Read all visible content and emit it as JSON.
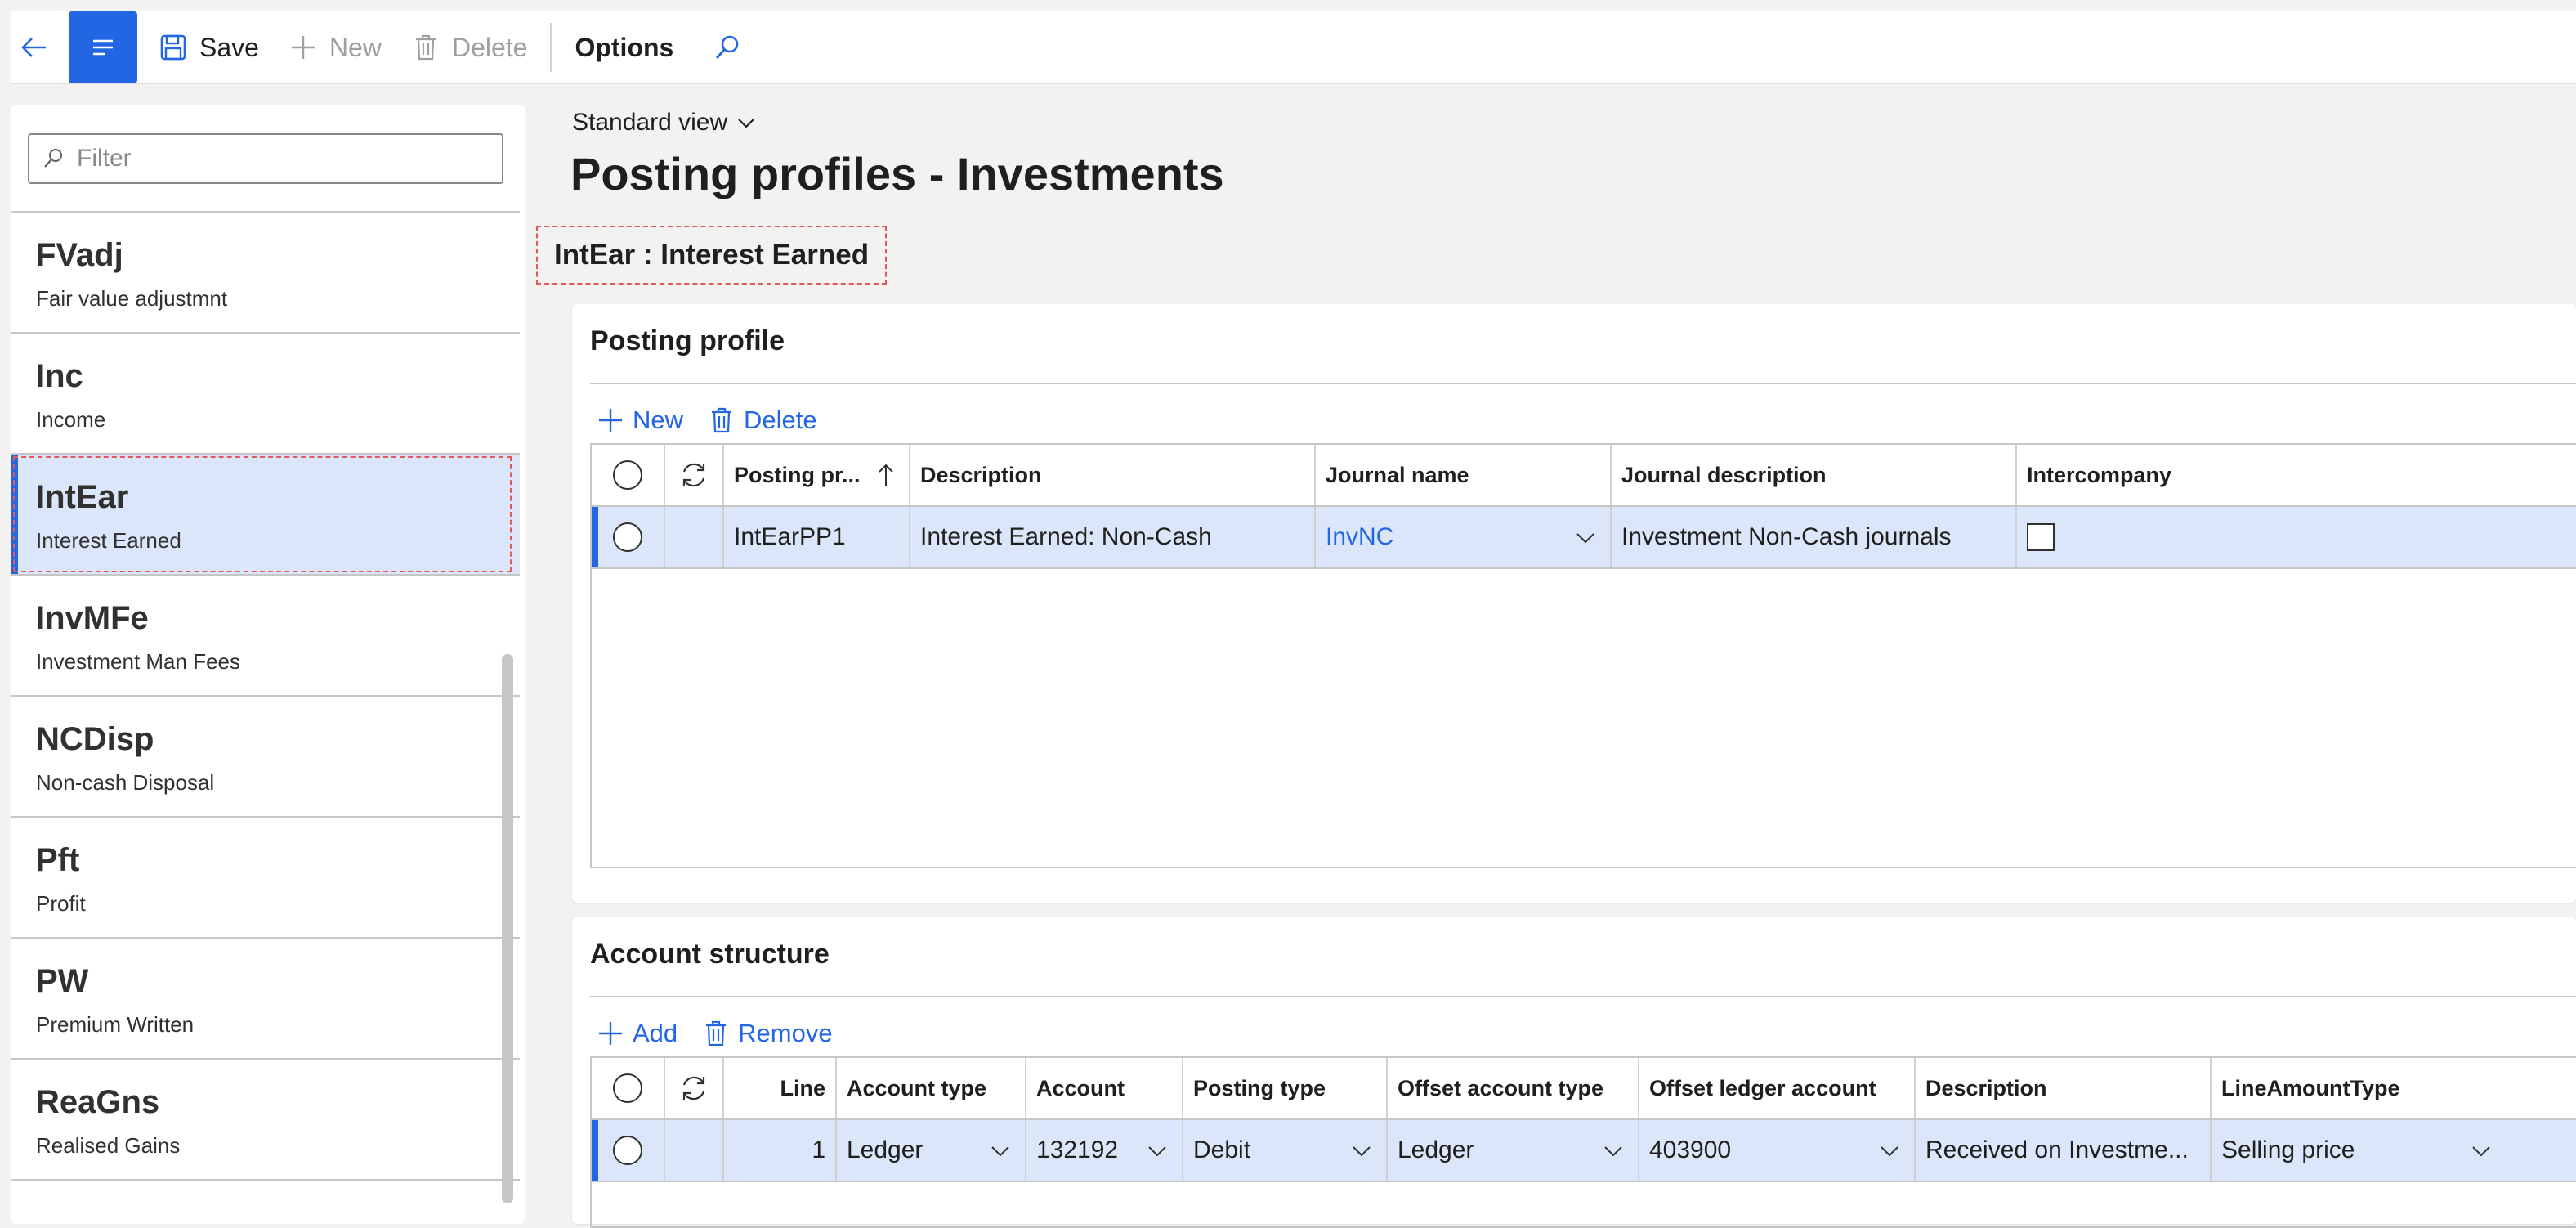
{
  "actionbar": {
    "save_label": "Save",
    "new_label": "New",
    "delete_label": "Delete",
    "options_label": "Options",
    "icons": [
      "back-arrow-icon",
      "hamburger-menu-icon",
      "save-icon",
      "plus-icon",
      "trash-icon",
      "search-icon"
    ]
  },
  "sidebar": {
    "filter_placeholder": "Filter",
    "items": [
      {
        "code": "FVadj",
        "description": "Fair value adjustmnt",
        "selected": false
      },
      {
        "code": "Inc",
        "description": "Income",
        "selected": false
      },
      {
        "code": "IntEar",
        "description": "Interest Earned",
        "selected": true
      },
      {
        "code": "InvMFe",
        "description": "Investment Man Fees",
        "selected": false
      },
      {
        "code": "NCDisp",
        "description": "Non-cash Disposal",
        "selected": false
      },
      {
        "code": "Pft",
        "description": "Profit",
        "selected": false
      },
      {
        "code": "PW",
        "description": "Premium Written",
        "selected": false
      },
      {
        "code": "ReaGns",
        "description": "Realised Gains",
        "selected": false
      }
    ]
  },
  "main": {
    "view_label": "Standard view",
    "page_title": "Posting profiles - Investments",
    "record_title": "IntEar : Interest Earned"
  },
  "posting_profile": {
    "title": "Posting profile",
    "new_label": "New",
    "delete_label": "Delete",
    "columns": [
      "Posting pr...",
      "Description",
      "Journal name",
      "Journal description",
      "Intercompany"
    ],
    "rows": [
      {
        "posting_profile": "IntEarPP1",
        "description": "Interest Earned: Non-Cash",
        "journal_name": "InvNC",
        "journal_description": "Investment Non-Cash journals",
        "intercompany": false
      }
    ]
  },
  "account_structure": {
    "title": "Account structure",
    "add_label": "Add",
    "remove_label": "Remove",
    "columns": [
      "Line",
      "Account type",
      "Account",
      "Posting type",
      "Offset account type",
      "Offset ledger account",
      "Description",
      "LineAmountType"
    ],
    "rows": [
      {
        "line": "1",
        "account_type": "Ledger",
        "account": "132192",
        "posting_type": "Debit",
        "offset_account_type": "Ledger",
        "offset_ledger_account": "403900",
        "description": "Received on Investme...",
        "line_amount_type": "Selling price"
      }
    ]
  },
  "colors": {
    "accent": "#2266e3",
    "selected_row": "#dbe6fb",
    "page_background": "#f3f2f1"
  }
}
